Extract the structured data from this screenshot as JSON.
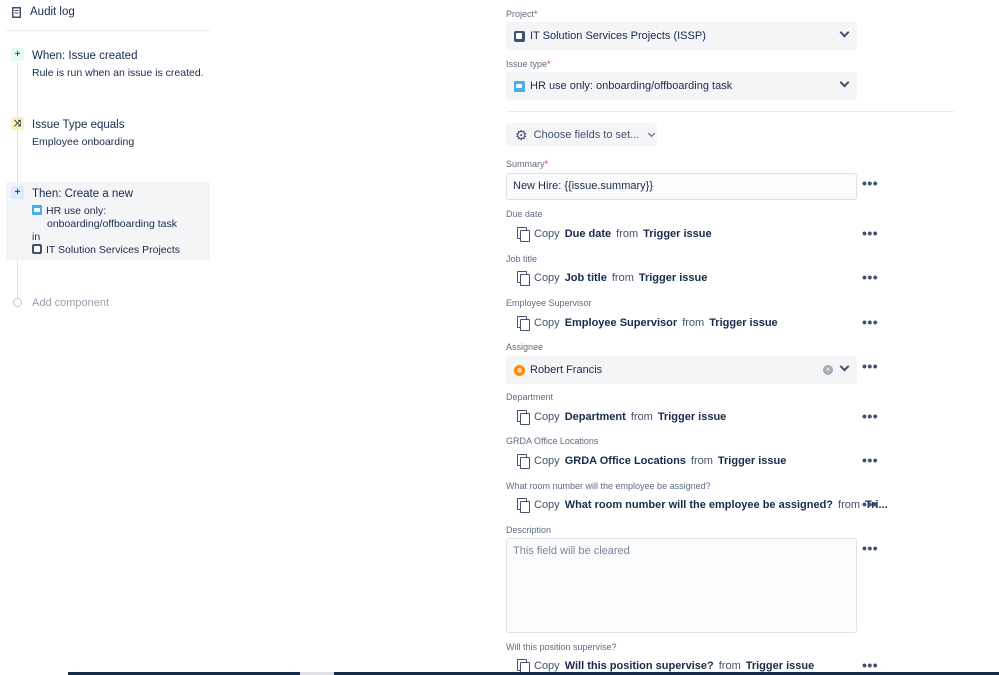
{
  "left": {
    "audit_log": "Audit log",
    "trigger": {
      "title": "When: Issue created",
      "subtitle": "Rule is run when an issue is created."
    },
    "condition": {
      "title": "Issue Type equals",
      "subtitle": "Employee onboarding"
    },
    "action": {
      "title": "Then: Create a new",
      "issue_type_line1": "HR use only:",
      "issue_type_line2": "onboarding/offboarding task",
      "in_label": "in",
      "project": "IT Solution Services Projects"
    },
    "add_component": "Add component"
  },
  "form": {
    "project": {
      "label": "Project",
      "required": "*",
      "value": "IT Solution Services Projects (ISSP)"
    },
    "issue_type": {
      "label": "Issue type",
      "required": "*",
      "value": "HR use only: onboarding/offboarding task"
    },
    "choose_fields": "Choose fields to set...",
    "summary": {
      "label": "Summary",
      "required": "*",
      "value": "New Hire: {{issue.summary}}"
    },
    "due_date": {
      "label": "Due date",
      "copy": "Copy",
      "field": "Due date",
      "from": "from",
      "source": "Trigger issue"
    },
    "job_title": {
      "label": "Job title",
      "copy": "Copy",
      "field": "Job title",
      "from": "from",
      "source": "Trigger issue"
    },
    "supervisor": {
      "label": "Employee Supervisor",
      "copy": "Copy",
      "field": "Employee Supervisor",
      "from": "from",
      "source": "Trigger issue"
    },
    "assignee": {
      "label": "Assignee",
      "value": "Robert Francis"
    },
    "department": {
      "label": "Department",
      "copy": "Copy",
      "field": "Department",
      "from": "from",
      "source": "Trigger issue"
    },
    "office": {
      "label": "GRDA Office Locations",
      "copy": "Copy",
      "field": "GRDA Office Locations",
      "from": "from",
      "source": "Trigger issue"
    },
    "room": {
      "label": "What room number will the employee be assigned?",
      "copy": "Copy",
      "field": "What room number will the employee be assigned?",
      "from": "from",
      "source": "Tri..."
    },
    "description": {
      "label": "Description",
      "placeholder": "This field will be cleared"
    },
    "supervise": {
      "label": "Will this position supervise?",
      "copy": "Copy",
      "field": "Will this position supervise?",
      "from": "from",
      "source": "Trigger issue"
    },
    "more": "•••"
  },
  "colors": {
    "accent": "#0052cc",
    "required": "#de350b",
    "field_bg": "#f4f5f7"
  }
}
